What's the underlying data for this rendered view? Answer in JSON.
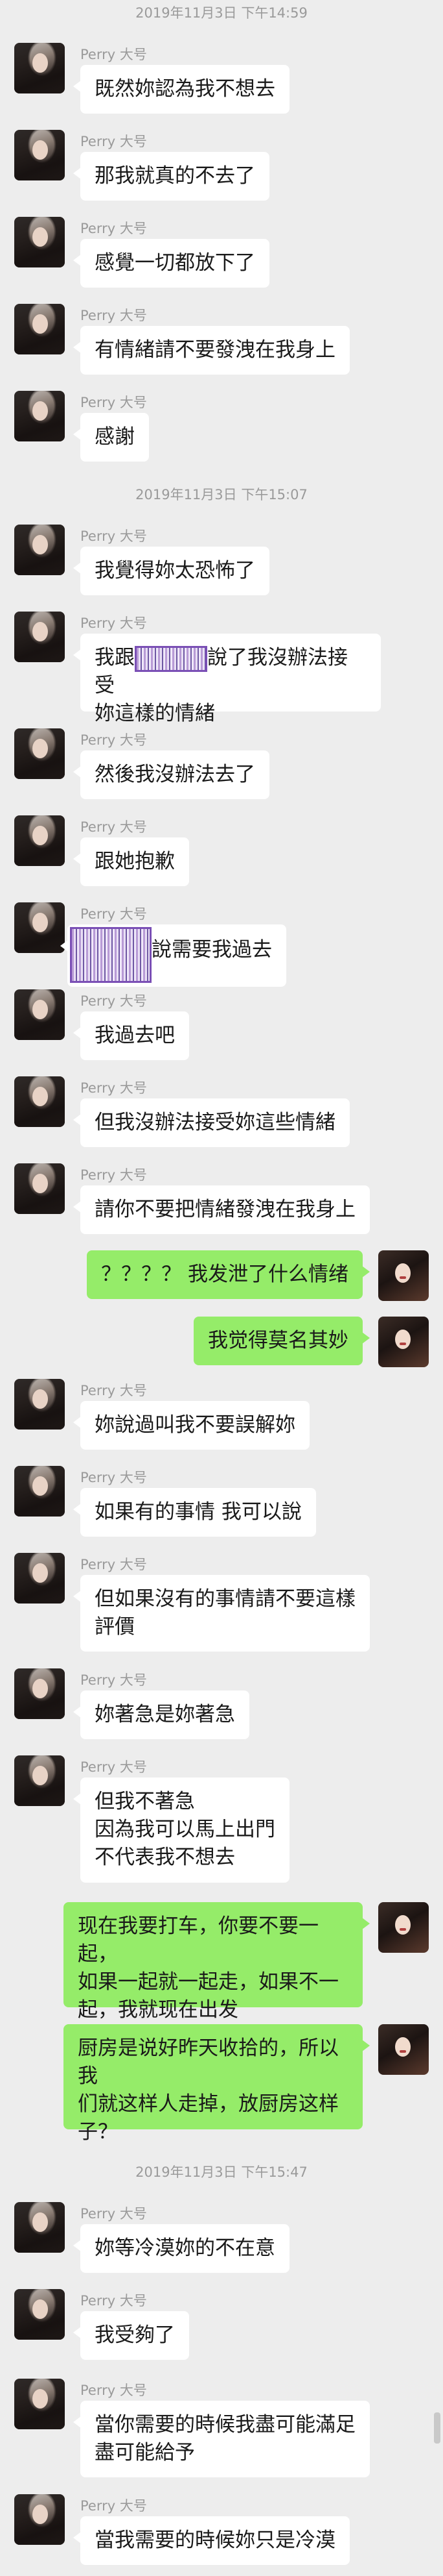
{
  "sender_name": "Perry 大号",
  "timestamps": [
    "2019年11月3日 下午14:59",
    "2019年11月3日 下午15:07",
    "2019年11月3日 下午15:47"
  ],
  "messages": [
    {
      "text": "既然妳認為我不想去"
    },
    {
      "text": "那我就真的不去了"
    },
    {
      "text": "感覺一切都放下了"
    },
    {
      "text": "有情緒請不要發洩在我身上"
    },
    {
      "text": "感謝"
    },
    {
      "text": "我覺得妳太恐怖了"
    },
    {
      "before": "我跟",
      "after": "說了我沒辦法接受\n妳這樣的情緒"
    },
    {
      "text": "然後我沒辦法去了"
    },
    {
      "text": "跟她抱歉"
    },
    {
      "after": "說需要我過去"
    },
    {
      "text": "我過去吧"
    },
    {
      "text": "但我沒辦法接受妳這些情緒"
    },
    {
      "text": "請你不要把情緒發洩在我身上"
    },
    {
      "text": "？？？？ 我发泄了什么情绪"
    },
    {
      "text": "我觉得莫名其妙"
    },
    {
      "text": "妳說過叫我不要誤解妳"
    },
    {
      "text": "如果有的事情 我可以說"
    },
    {
      "text": "但如果沒有的事情請不要這樣\n評價"
    },
    {
      "text": "妳著急是妳著急"
    },
    {
      "text": "但我不著急\n因為我可以馬上出門\n不代表我不想去"
    },
    {
      "text": "现在我要打车，你要不要一起，\n如果一起就一起走，如果不一\n起，我就现在出发"
    },
    {
      "text": "厨房是说好昨天收拾的，所以我\n们就这样人走掉，放厨房这样\n子？"
    },
    {
      "text": "妳等冷漠妳的不在意"
    },
    {
      "text": "我受夠了"
    },
    {
      "text": "當你需要的時候我盡可能滿足\n盡可能給予"
    },
    {
      "text": "當我需要的時候妳只是冷漠"
    }
  ]
}
